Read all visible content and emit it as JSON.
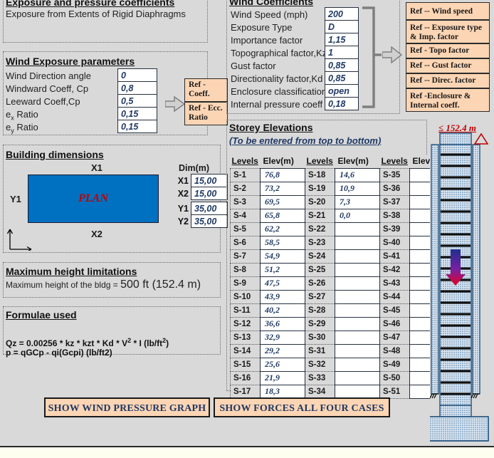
{
  "colors": {
    "page_bg": "#d9d9d9",
    "ref_button": "#fcd5b4",
    "input_text": "#1f3864",
    "plan_fill": "#0070c0",
    "plan_label": "#c00000",
    "height_note": "#c00000",
    "building_fill": "#dce6f1",
    "building_stroke": "#1f4e79"
  },
  "exposure_section": {
    "title": "Exposure and pressure coefficients",
    "description": "Exposure from Extents of Rigid Diaphragms"
  },
  "wind_exposure": {
    "title": "Wind Exposure parameters",
    "rows": [
      {
        "label": "Wind Direction angle",
        "value": "0"
      },
      {
        "label": "Windward Coeff, Cp",
        "value": "0,8"
      },
      {
        "label": "Leeward Coeff,Cp",
        "value": "0,5"
      },
      {
        "label": "e",
        "sub": "x",
        "label_tail": " Ratio",
        "value": "0,15"
      },
      {
        "label": "e",
        "sub": "y",
        "label_tail": " Ratio",
        "value": "0,15"
      }
    ],
    "ref_buttons": [
      "Ref - Coeff.",
      "Ref - Ecc. Ratio"
    ]
  },
  "wind_coefficients": {
    "title": "Wind Coefficients",
    "rows": [
      {
        "label": "Wind Speed  (mph)",
        "value": "200"
      },
      {
        "label": "Exposure Type",
        "value": "D"
      },
      {
        "label": "Importance factor",
        "value": "1,15"
      },
      {
        "label": "Topographical factor,Kzt",
        "value": "1"
      },
      {
        "label": "Gust factor",
        "value": "0,85"
      },
      {
        "label": "Directionality factor,Kd",
        "value": "0,85"
      },
      {
        "label": "Enclosure classification",
        "value": "open"
      },
      {
        "label": "Internal pressure coeff",
        "value": "0,18"
      }
    ],
    "ref_buttons": [
      "Ref -- Wind speed",
      "Ref -- Exposure type & Imp. factor",
      "Ref - Topo factor",
      "Ref -- Gust factor",
      "Ref -- Direc. factor",
      "Ref -Enclosure & Internal coeff."
    ]
  },
  "building_dimensions": {
    "title": "Building dimensions",
    "plan_label": "PLAN",
    "edge_top": "X1",
    "edge_bottom": "X2",
    "edge_left": "Y1",
    "dim_header": "Dim(m)",
    "dims": [
      {
        "label": "X1",
        "value": "15,00"
      },
      {
        "label": "X2",
        "value": "15,00"
      },
      {
        "label": "Y1",
        "value": "35,00"
      },
      {
        "label": "Y2",
        "value": "35,00"
      }
    ]
  },
  "max_height": {
    "title": "Maximum height limitations",
    "label": "Maximum height of the bldg = ",
    "value": "500 ft (152.4 m)"
  },
  "formulae": {
    "title": "Formulae used",
    "line1_pre": "Qz = 0.00256 * kz * kzt * Kd * V",
    "line1_sup": "2",
    "line1_mid": " * I  (lb/ft",
    "line1_sup2": "2",
    "line1_post": ")",
    "line2": "p = qGCp - qi(Gcpi)   (lb/ft2)"
  },
  "storey": {
    "title": "Storey Elevations",
    "subtitle": "(To be entered from top to bottom)",
    "headers": [
      "Levels",
      "Elev(m)",
      "Levels",
      "Elev(m)",
      "Levels",
      "Elev(m)"
    ],
    "rows": [
      {
        "l1": "S-1",
        "e1": "76,8",
        "l2": "S-18",
        "e2": "14,6",
        "l3": "S-35",
        "e3": ""
      },
      {
        "l1": "S-2",
        "e1": "73,2",
        "l2": "S-19",
        "e2": "10,9",
        "l3": "S-36",
        "e3": ""
      },
      {
        "l1": "S-3",
        "e1": "69,5",
        "l2": "S-20",
        "e2": "7,3",
        "l3": "S-37",
        "e3": ""
      },
      {
        "l1": "S-4",
        "e1": "65,8",
        "l2": "S-21",
        "e2": "0,0",
        "l3": "S-38",
        "e3": ""
      },
      {
        "l1": "S-5",
        "e1": "62,2",
        "l2": "S-22",
        "e2": "",
        "l3": "S-39",
        "e3": ""
      },
      {
        "l1": "S-6",
        "e1": "58,5",
        "l2": "S-23",
        "e2": "",
        "l3": "S-40",
        "e3": ""
      },
      {
        "l1": "S-7",
        "e1": "54,9",
        "l2": "S-24",
        "e2": "",
        "l3": "S-41",
        "e3": ""
      },
      {
        "l1": "S-8",
        "e1": "51,2",
        "l2": "S-25",
        "e2": "",
        "l3": "S-42",
        "e3": ""
      },
      {
        "l1": "S-9",
        "e1": "47,5",
        "l2": "S-26",
        "e2": "",
        "l3": "S-43",
        "e3": ""
      },
      {
        "l1": "S-10",
        "e1": "43,9",
        "l2": "S-27",
        "e2": "",
        "l3": "S-44",
        "e3": ""
      },
      {
        "l1": "S-11",
        "e1": "40,2",
        "l2": "S-28",
        "e2": "",
        "l3": "S-45",
        "e3": ""
      },
      {
        "l1": "S-12",
        "e1": "36,6",
        "l2": "S-29",
        "e2": "",
        "l3": "S-46",
        "e3": ""
      },
      {
        "l1": "S-13",
        "e1": "32,9",
        "l2": "S-30",
        "e2": "",
        "l3": "S-47",
        "e3": ""
      },
      {
        "l1": "S-14",
        "e1": "29,2",
        "l2": "S-31",
        "e2": "",
        "l3": "S-48",
        "e3": ""
      },
      {
        "l1": "S-15",
        "e1": "25,6",
        "l2": "S-32",
        "e2": "",
        "l3": "S-49",
        "e3": ""
      },
      {
        "l1": "S-16",
        "e1": "21,9",
        "l2": "S-33",
        "e2": "",
        "l3": "S-50",
        "e3": ""
      },
      {
        "l1": "S-17",
        "e1": "18,3",
        "l2": "S-34",
        "e2": "",
        "l3": "S-51",
        "e3": ""
      }
    ]
  },
  "elevation_diagram": {
    "height_limit_note": "≤ 152.4 m"
  },
  "buttons": {
    "graph": "SHOW WIND PRESSURE GRAPH",
    "forces": "SHOW FORCES ALL FOUR CASES"
  }
}
